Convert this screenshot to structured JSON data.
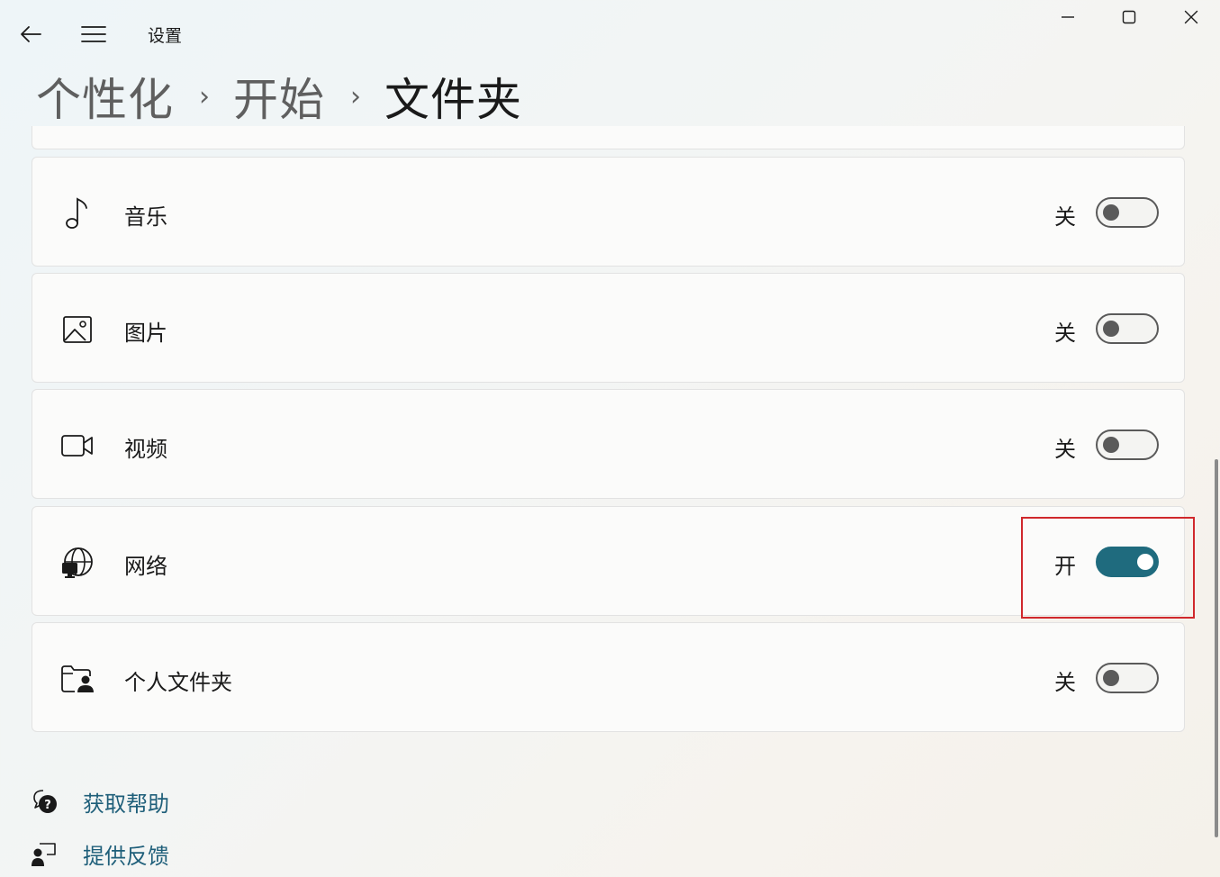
{
  "app": {
    "title": "设置"
  },
  "breadcrumb": {
    "items": [
      "个性化",
      "开始",
      "文件夹"
    ],
    "separator": "›"
  },
  "folders": [
    {
      "icon": "music-note-icon",
      "label": "音乐",
      "state": "关",
      "on": false
    },
    {
      "icon": "picture-icon",
      "label": "图片",
      "state": "关",
      "on": false
    },
    {
      "icon": "video-camera-icon",
      "label": "视频",
      "state": "关",
      "on": false
    },
    {
      "icon": "network-globe-icon",
      "label": "网络",
      "state": "开",
      "on": true
    },
    {
      "icon": "personal-folder-icon",
      "label": "个人文件夹",
      "state": "关",
      "on": false
    }
  ],
  "footer": {
    "help": {
      "icon": "help-chat-icon",
      "label": "获取帮助"
    },
    "feedback": {
      "icon": "feedback-icon",
      "label": "提供反馈"
    }
  },
  "colors": {
    "accent": "#1f6b7e",
    "link": "#1f5f7a",
    "highlight": "#d0282c"
  }
}
